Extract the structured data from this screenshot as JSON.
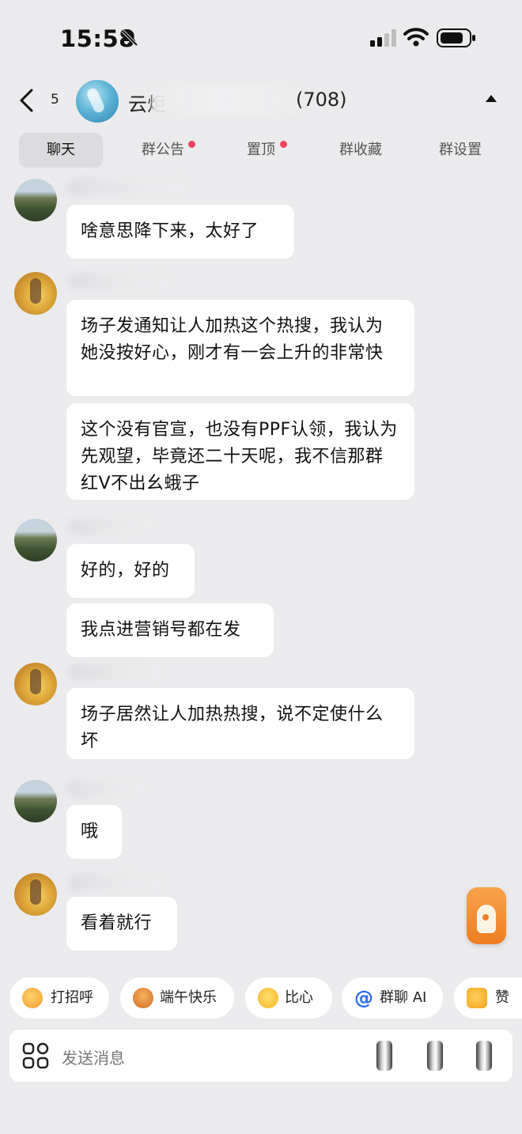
{
  "status_bar": {
    "time": "15:58"
  },
  "header": {
    "unread_count": "5",
    "group_name": "云炬",
    "member_count": "(708)"
  },
  "tabs": [
    {
      "label": "聊天",
      "active": true,
      "dot": false
    },
    {
      "label": "群公告",
      "active": false,
      "dot": true
    },
    {
      "label": "置顶",
      "active": false,
      "dot": true
    },
    {
      "label": "群收藏",
      "active": false,
      "dot": false
    },
    {
      "label": "群设置",
      "active": false,
      "dot": false
    }
  ],
  "messages": [
    {
      "bubbles": [
        "啥意思降下来，太好了"
      ]
    },
    {
      "bubbles": [
        "场子发通知让人加热这个热搜，我认为她没按好心，刚才有一会上升的非常快",
        "这个没有官宣，也没有PPF认领，我认为先观望，毕竟还二十天呢，我不信那群红V不出幺蛾子"
      ]
    },
    {
      "bubbles": [
        "好的，好的",
        "我点进营销号都在发"
      ]
    },
    {
      "bubbles": [
        "场子居然让人加热热搜，说不定使什么坏"
      ]
    },
    {
      "bubbles": [
        "哦"
      ]
    },
    {
      "bubbles": [
        "看着就行"
      ]
    }
  ],
  "quick_replies": [
    {
      "label": "打招呼",
      "icon": "wave-emoji-icon"
    },
    {
      "label": "端午快乐",
      "icon": "festival-emoji-icon"
    },
    {
      "label": "比心",
      "icon": "heart-hands-emoji-icon"
    },
    {
      "label": "群聊 AI",
      "icon": "at-icon"
    },
    {
      "label": "赞",
      "icon": "thumbs-up-icon"
    }
  ],
  "input": {
    "placeholder": "发送消息"
  },
  "colors": {
    "background": "#ebebed",
    "bubble": "#ffffff",
    "red_dot": "#f0435e",
    "ai_blue": "#2c6bf0"
  }
}
